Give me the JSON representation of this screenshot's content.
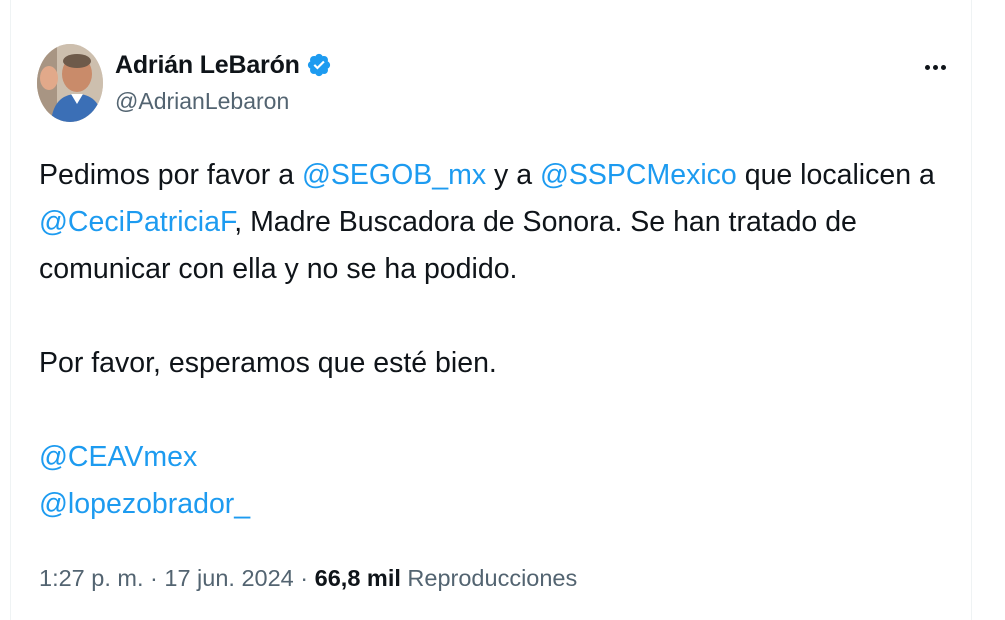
{
  "author": {
    "display_name": "Adrián LeBarón",
    "handle": "@AdrianLebaron",
    "verified": true,
    "avatar_icon": "profile-photo"
  },
  "menu_icon": "more-horizontal-icon",
  "tweet": {
    "line1_a": "Pedimos por favor a ",
    "mention_segob": "@SEGOB_mx",
    "line1_b": " y a ",
    "mention_sspc": "@SSPCMexico",
    "line1_c": " que localicen a",
    "mention_ceci": "@CeciPatriciaF",
    "line2_rest": ", Madre Buscadora de Sonora. Se han tratado de",
    "line3": "comunicar con ella y no se ha podido.",
    "paragraph2": "Por favor, esperamos que esté bien.",
    "mention_ceav": "@CEAVmex",
    "mention_amlo": "@lopezobrador_"
  },
  "meta": {
    "time": "1:27 p. m.",
    "sep1": " · ",
    "date": "17 jun. 2024",
    "sep2": " · ",
    "views_count": "66,8 mil",
    "views_label": " Reproducciones"
  },
  "colors": {
    "link": "#1d9bf0",
    "text": "#0f1419",
    "secondary": "#536471",
    "verified_badge": "#1d9bf0"
  }
}
